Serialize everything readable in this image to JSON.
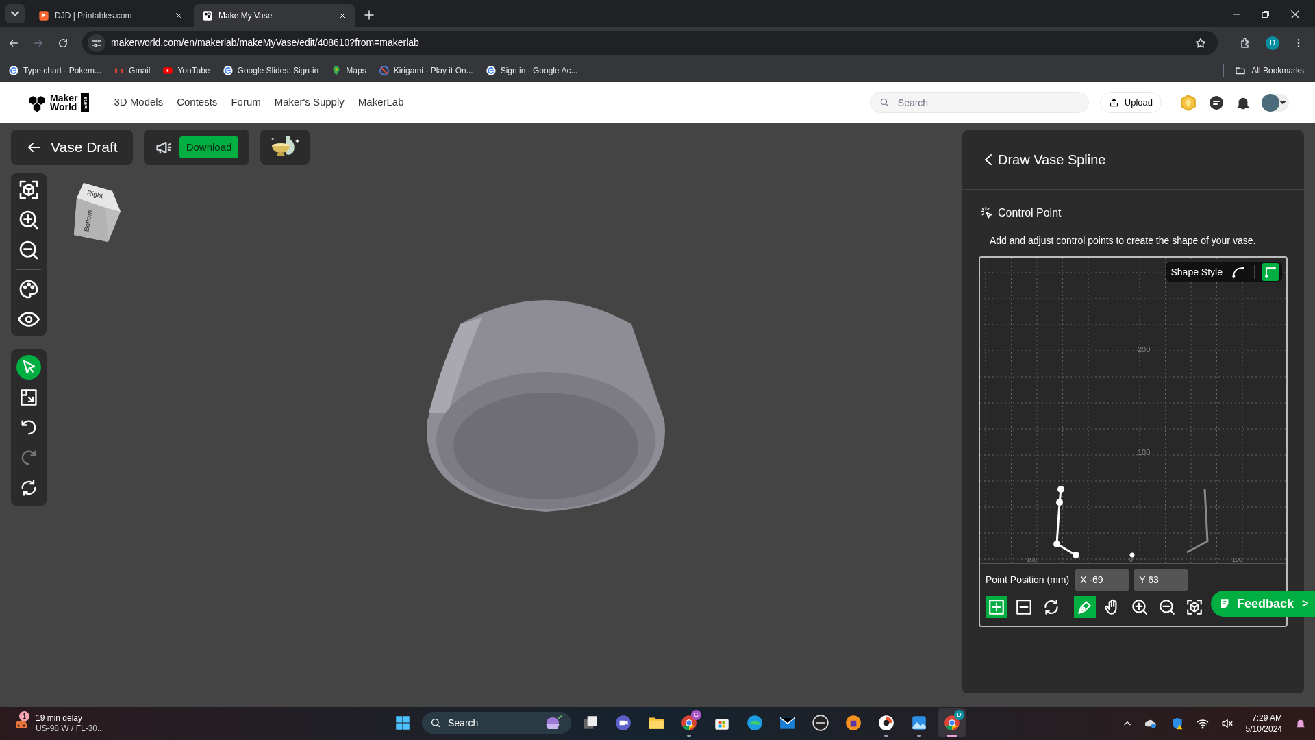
{
  "browser": {
    "tabs": [
      {
        "title": "DJD | Printables.com",
        "kind": "printables",
        "selected": false
      },
      {
        "title": "Make My Vase",
        "kind": "makerworld",
        "selected": true
      }
    ],
    "url": "makerworld.com/en/makerlab/makeMyVase/edit/408610?from=makerlab",
    "profile_initial": "D",
    "bookmarks": [
      {
        "label": "Type chart - Pokem...",
        "kind": "google"
      },
      {
        "label": "Gmail",
        "kind": "gmail"
      },
      {
        "label": "YouTube",
        "kind": "youtube"
      },
      {
        "label": "Google Slides: Sign-in",
        "kind": "google"
      },
      {
        "label": "Maps",
        "kind": "maps"
      },
      {
        "label": "Kirigami - Play it On...",
        "kind": "kirigami"
      },
      {
        "label": "Sign in - Google Ac...",
        "kind": "google"
      }
    ],
    "all_bookmarks": "All Bookmarks"
  },
  "site_header": {
    "logo": {
      "line1": "Maker",
      "line2": "World",
      "badge": "Beta"
    },
    "nav": [
      "3D Models",
      "Contests",
      "Forum",
      "Maker's Supply",
      "MakerLab"
    ],
    "search_placeholder": "Search",
    "upload": "Upload"
  },
  "editor": {
    "title": "Vase Draft",
    "download": "Download",
    "nav_cube": {
      "top": "Right",
      "side": "Bottom"
    },
    "view_tools": [
      {
        "kind": "fit"
      },
      {
        "kind": "zoom-in"
      },
      {
        "kind": "zoom-out"
      },
      {
        "kind": "palette"
      },
      {
        "kind": "eye"
      }
    ],
    "edit_tools": [
      {
        "kind": "select",
        "selected": true,
        "disabled": false
      },
      {
        "kind": "scale",
        "selected": false,
        "disabled": false
      },
      {
        "kind": "undo",
        "selected": false,
        "disabled": false
      },
      {
        "kind": "redo",
        "selected": false,
        "disabled": true
      },
      {
        "kind": "reset",
        "selected": false,
        "disabled": false
      }
    ]
  },
  "panel": {
    "title": "Draw Vase Spline",
    "section": "Control Point",
    "description": "Add and adjust control points to create the shape of your vase.",
    "shape_style": {
      "label": "Shape Style",
      "options": [
        {
          "kind": "curve",
          "selected": false
        },
        {
          "kind": "corner",
          "selected": true
        }
      ]
    },
    "canvas": {
      "y_labels": [
        "200",
        "100"
      ],
      "x_labels": [
        "100",
        "0",
        "100"
      ]
    },
    "point_position": {
      "label": "Point Position (mm)",
      "x": "X -69",
      "y": "Y 63"
    },
    "tools": [
      {
        "kind": "add",
        "selected": true
      },
      {
        "kind": "remove",
        "selected": false
      },
      {
        "kind": "refresh",
        "selected": false
      },
      {
        "kind": "pen",
        "selected": true
      },
      {
        "kind": "hand",
        "selected": false
      },
      {
        "kind": "zoom-in",
        "selected": false
      },
      {
        "kind": "zoom-out",
        "selected": false
      },
      {
        "kind": "fit",
        "selected": false
      }
    ],
    "feedback": "Feedback",
    "feedback_arrow": ">"
  },
  "taskbar": {
    "weather": {
      "badge": "1",
      "line1": "19 min delay",
      "line2": "US-98 W / FL-30..."
    },
    "search": "Search",
    "apps": [
      {
        "kind": "start",
        "running": false,
        "active": false
      },
      {
        "kind": "taskview",
        "running": false,
        "active": false
      },
      {
        "kind": "meet",
        "running": false,
        "active": false
      },
      {
        "kind": "folder",
        "running": false,
        "active": false
      },
      {
        "kind": "chrome",
        "badge": "G",
        "running": true,
        "active": false
      },
      {
        "kind": "store",
        "running": false,
        "active": false
      },
      {
        "kind": "edge",
        "running": false,
        "active": false
      },
      {
        "kind": "mail",
        "running": false,
        "active": false
      },
      {
        "kind": "dell",
        "running": false,
        "active": false
      },
      {
        "kind": "vpn",
        "running": false,
        "active": false
      },
      {
        "kind": "orange",
        "running": true,
        "active": false
      },
      {
        "kind": "photos",
        "running": true,
        "active": false
      },
      {
        "kind": "chrome",
        "badge": "D",
        "running": true,
        "active": true
      }
    ],
    "time": "7:29 AM",
    "date": "5/10/2024"
  }
}
